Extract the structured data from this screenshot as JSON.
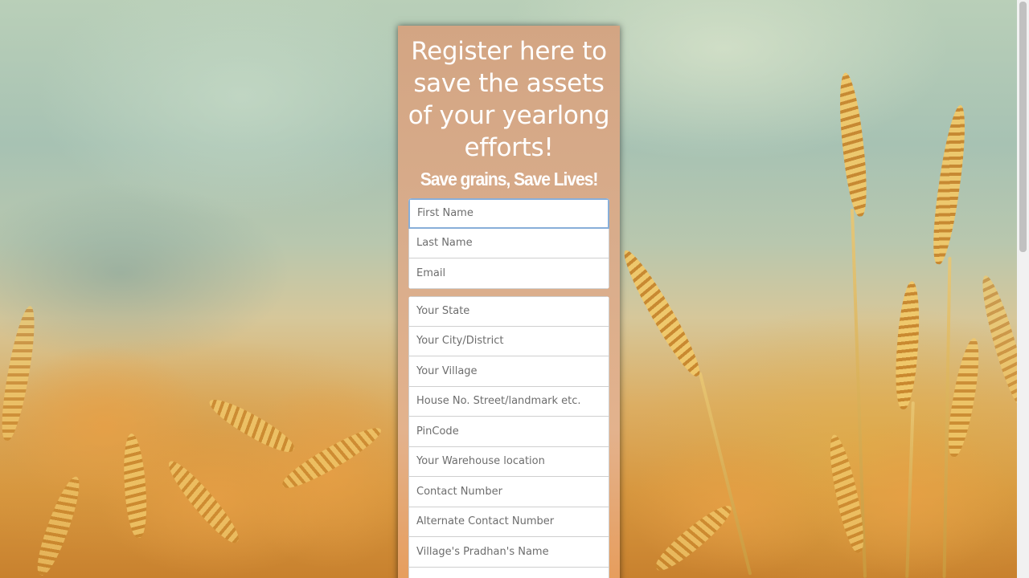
{
  "header": {
    "headline": "Register here to save the assets of your yearlong efforts!",
    "tagline": "Save grains, Save Lives!"
  },
  "form": {
    "personal": {
      "first_name_placeholder": "First Name",
      "last_name_placeholder": "Last Name",
      "email_placeholder": "Email"
    },
    "address": {
      "state_placeholder": "Your State",
      "city_placeholder": "Your City/District",
      "village_placeholder": "Your Village",
      "street_placeholder": "House No. Street/landmark etc.",
      "pincode_placeholder": "PinCode",
      "warehouse_placeholder": "Your Warehouse location",
      "contact_placeholder": "Contact Number",
      "alt_contact_placeholder": "Alternate Contact Number",
      "pradhan_placeholder": "Village's Pradhan's Name"
    }
  },
  "colors": {
    "panel_top": "#d3a583",
    "panel_bottom": "#e79a55",
    "focus_ring": "#88aed8",
    "heading_text": "#ffffff"
  },
  "icons": {
    "background": "wheat-field-photo"
  }
}
